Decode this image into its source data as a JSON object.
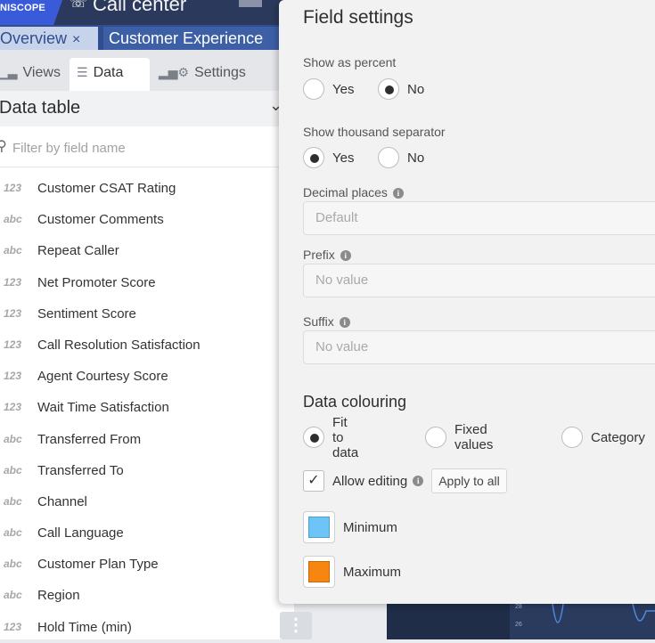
{
  "app": {
    "brand": "NISCOPE",
    "title": "Call center"
  },
  "tabs": [
    {
      "label": "Overview",
      "close": "×"
    },
    {
      "label": "Customer Experience"
    }
  ],
  "panel": {
    "subtabs": [
      {
        "label": "Views",
        "icon": "bar-chart-icon"
      },
      {
        "label": "Data",
        "icon": "database-icon"
      },
      {
        "label": "Settings",
        "icon": "chart-settings-icon"
      }
    ],
    "data_table_title": "Data table",
    "filter_placeholder": "Filter by field name",
    "fields": [
      {
        "type": "123",
        "name": "Customer CSAT Rating"
      },
      {
        "type": "abc",
        "name": "Customer Comments"
      },
      {
        "type": "abc",
        "name": "Repeat Caller"
      },
      {
        "type": "123",
        "name": "Net Promoter Score"
      },
      {
        "type": "123",
        "name": "Sentiment Score"
      },
      {
        "type": "123",
        "name": "Call Resolution Satisfaction"
      },
      {
        "type": "123",
        "name": "Agent Courtesy Score"
      },
      {
        "type": "123",
        "name": "Wait Time Satisfaction"
      },
      {
        "type": "abc",
        "name": "Transferred From"
      },
      {
        "type": "abc",
        "name": "Transferred To"
      },
      {
        "type": "abc",
        "name": "Channel"
      },
      {
        "type": "abc",
        "name": "Call Language"
      },
      {
        "type": "abc",
        "name": "Customer Plan Type"
      },
      {
        "type": "abc",
        "name": "Region"
      },
      {
        "type": "123",
        "name": "Hold Time (min)"
      }
    ]
  },
  "chart_ticks": [
    "28",
    "26"
  ],
  "modal": {
    "title": "Field settings",
    "show_percent": {
      "label": "Show as percent",
      "options": [
        "Yes",
        "No"
      ],
      "selected": "No"
    },
    "thousand_sep": {
      "label": "Show thousand separator",
      "options": [
        "Yes",
        "No"
      ],
      "selected": "Yes"
    },
    "decimal": {
      "label": "Decimal places",
      "placeholder": "Default"
    },
    "prefix": {
      "label": "Prefix",
      "placeholder": "No value"
    },
    "suffix": {
      "label": "Suffix",
      "placeholder": "No value"
    },
    "colouring": {
      "title": "Data colouring",
      "options": [
        "Fit to data",
        "Fixed values",
        "Category"
      ],
      "selected": "Fit to data"
    },
    "allow_editing": {
      "label": "Allow editing",
      "checked": true,
      "apply_label": "Apply to all"
    },
    "minimum": {
      "label": "Minimum",
      "color": "#6cc4f7"
    },
    "maximum": {
      "label": "Maximum",
      "color": "#f6860f"
    }
  }
}
